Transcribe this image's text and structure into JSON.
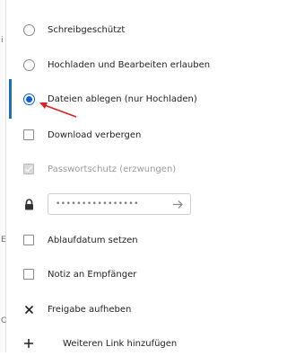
{
  "edge_fragments": [
    "i",
    "E",
    "C"
  ],
  "options": {
    "read_only": "Schreibgeschützt",
    "upload_edit": "Hochladen und Bearbeiten erlauben",
    "file_drop": "Dateien ablegen (nur Hochladen)",
    "hide_download": "Download verbergen",
    "password_enforced": "Passwortschutz (erzwungen)",
    "password_value": "••••••••••••••••",
    "set_expiration": "Ablaufdatum setzen",
    "note_to_recipient": "Notiz an Empfänger",
    "unshare": "Freigabe aufheben",
    "add_link": "Weiteren Link hinzufügen"
  },
  "state": {
    "selected_permission": "file_drop",
    "hide_download": false,
    "password_enforced": true,
    "set_expiration": false,
    "note_to_recipient": false
  },
  "colors": {
    "accent": "#0b5ed7",
    "annotation_arrow": "#e02020"
  },
  "icons": {
    "password": "lock-icon",
    "submit_password": "arrow-right-icon",
    "unshare": "close-icon",
    "add_link": "plus-icon"
  }
}
